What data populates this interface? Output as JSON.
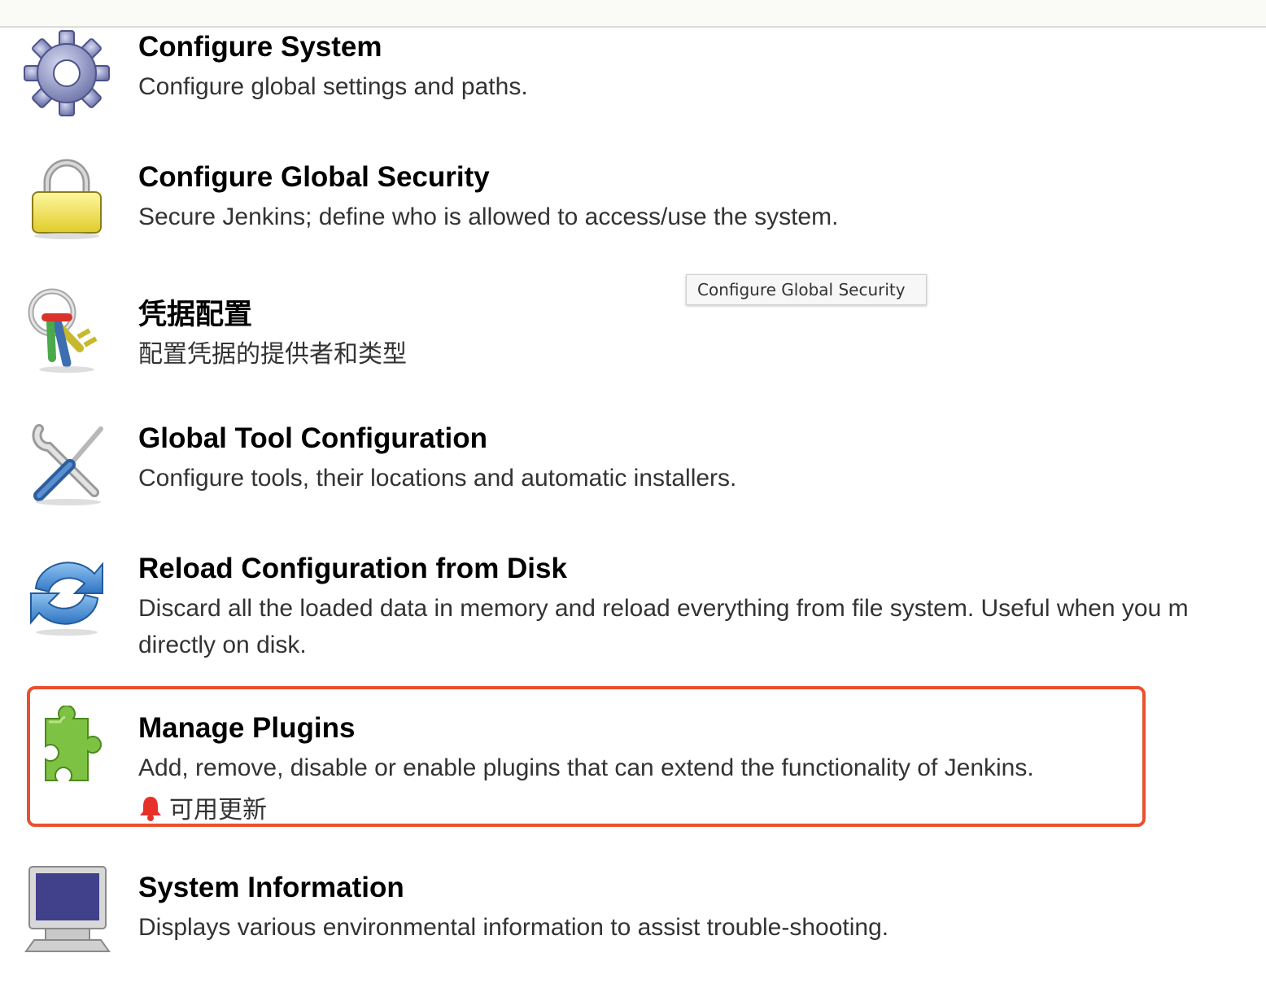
{
  "tooltip": {
    "text": "Configure Global Security"
  },
  "items": [
    {
      "title": "Configure System",
      "description": "Configure global settings and paths.",
      "icon": "gear-icon"
    },
    {
      "title": "Configure Global Security",
      "description": "Secure Jenkins; define who is allowed to access/use the system.",
      "icon": "lock-icon"
    },
    {
      "title": "凭据配置",
      "description": "配置凭据的提供者和类型",
      "icon": "keys-icon"
    },
    {
      "title": "Global Tool Configuration",
      "description": "Configure tools, their locations and automatic installers.",
      "icon": "tools-icon"
    },
    {
      "title": "Reload Configuration from Disk",
      "description_line1": "Discard all the loaded data in memory and reload everything from file system. Useful when you m",
      "description_line2": "directly on disk.",
      "icon": "reload-icon"
    },
    {
      "title": "Manage Plugins",
      "description": "Add, remove, disable or enable plugins that can extend the functionality of Jenkins.",
      "update_notice": "可用更新",
      "icon": "puzzle-icon"
    },
    {
      "title": "System Information",
      "description": "Displays various environmental information to assist trouble-shooting.",
      "icon": "computer-icon"
    }
  ],
  "colors": {
    "highlight_border": "#e8502f",
    "bell": "#e8302a"
  }
}
